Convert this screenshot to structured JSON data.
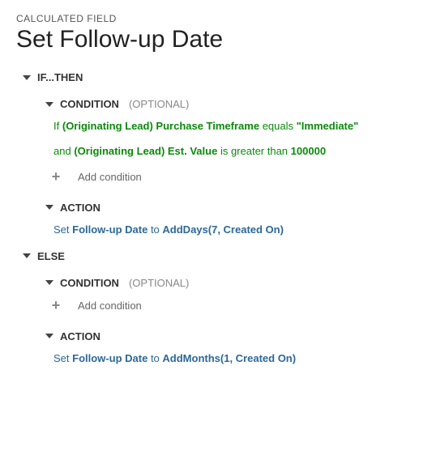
{
  "header": {
    "subtitle": "CALCULATED FIELD",
    "title": "Set Follow-up Date"
  },
  "ifthen": {
    "label": "IF...THEN",
    "condition": {
      "label": "CONDITION",
      "optional": "(OPTIONAL)",
      "line1": {
        "prefix": "If",
        "field": "(Originating Lead) Purchase Timeframe",
        "op": "equals",
        "value": "\"Immediate\""
      },
      "line2": {
        "prefix": "and",
        "field": "(Originating Lead) Est. Value",
        "op": "is greater than",
        "value": "100000"
      },
      "add": "Add condition"
    },
    "action": {
      "label": "ACTION",
      "set": "Set",
      "field": "Follow-up Date",
      "to": "to",
      "fn": "AddDays(7, Created On)"
    }
  },
  "else": {
    "label": "ELSE",
    "condition": {
      "label": "CONDITION",
      "optional": "(OPTIONAL)",
      "add": "Add condition"
    },
    "action": {
      "label": "ACTION",
      "set": "Set",
      "field": "Follow-up Date",
      "to": "to",
      "fn": "AddMonths(1, Created On)"
    }
  }
}
